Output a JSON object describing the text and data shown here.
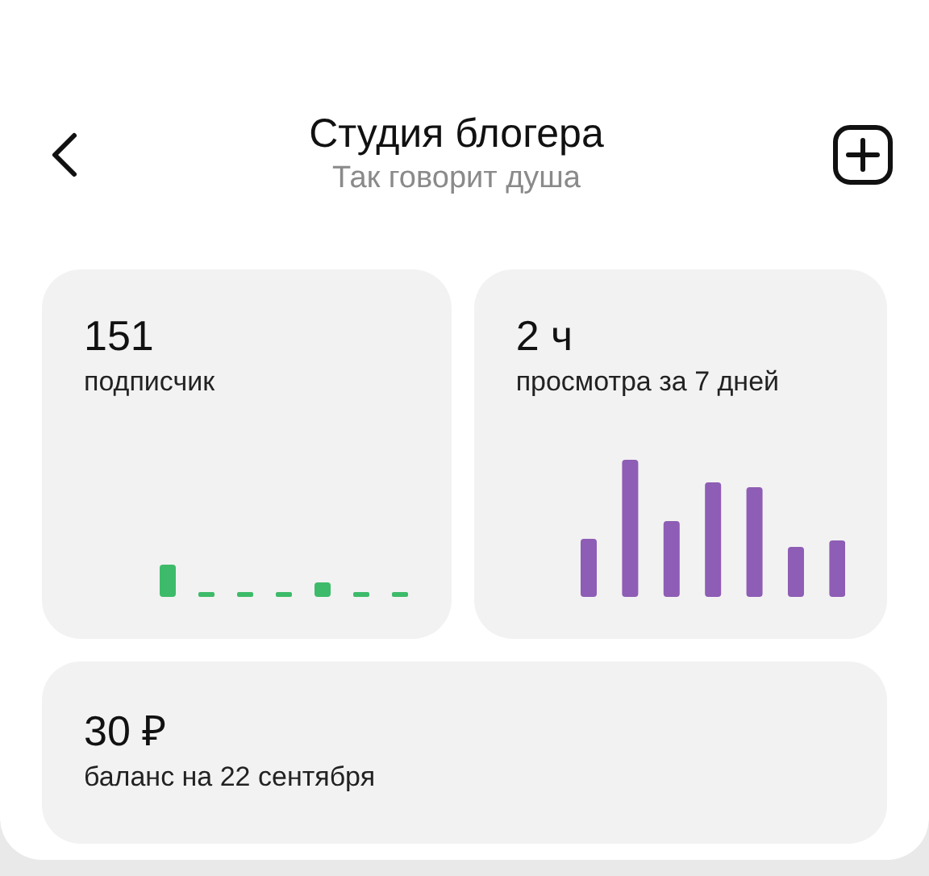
{
  "header": {
    "title": "Студия блогера",
    "subtitle": "Так говорит душа"
  },
  "stats": [
    {
      "value": "151",
      "label": "подписчик"
    },
    {
      "value": "2 ч",
      "label": "просмотра за 7 дней"
    }
  ],
  "balance": {
    "value": "30 ₽",
    "label": "баланс на 22 сентября"
  }
}
